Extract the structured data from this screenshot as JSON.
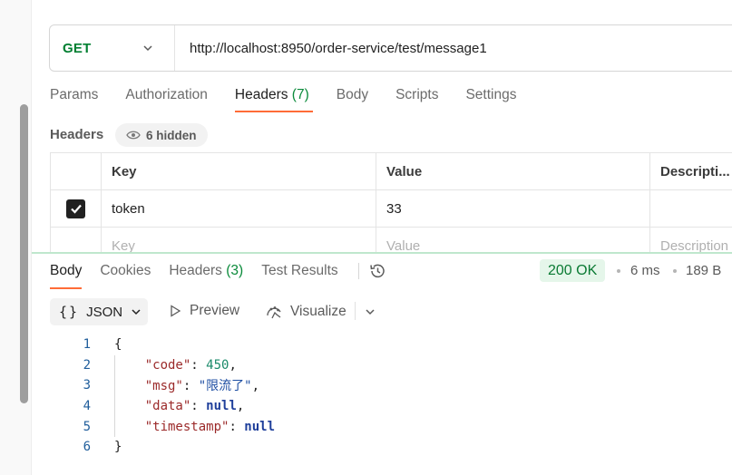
{
  "request": {
    "method": "GET",
    "url": "http://localhost:8950/order-service/test/message1"
  },
  "request_tabs": [
    {
      "label": "Params",
      "count": ""
    },
    {
      "label": "Authorization",
      "count": ""
    },
    {
      "label": "Headers",
      "count": "(7)"
    },
    {
      "label": "Body",
      "count": ""
    },
    {
      "label": "Scripts",
      "count": ""
    },
    {
      "label": "Settings",
      "count": ""
    }
  ],
  "headers_section": {
    "title": "Headers",
    "hidden_label": "6 hidden"
  },
  "headers_table": {
    "columns": [
      "Key",
      "Value",
      "Descripti..."
    ],
    "rows": [
      {
        "checked": true,
        "key": "token",
        "value": "33",
        "description": ""
      }
    ],
    "placeholder": {
      "key": "Key",
      "value": "Value",
      "description": "Description"
    }
  },
  "response_tabs": [
    {
      "label": "Body",
      "count": ""
    },
    {
      "label": "Cookies",
      "count": ""
    },
    {
      "label": "Headers",
      "count": "(3)"
    },
    {
      "label": "Test Results",
      "count": ""
    }
  ],
  "response_meta": {
    "status": "200 OK",
    "time": "6 ms",
    "size": "189 B"
  },
  "response_toolbar": {
    "format": "JSON",
    "preview": "Preview",
    "visualize": "Visualize"
  },
  "code_lines": [
    {
      "n": "1",
      "text": "{"
    },
    {
      "n": "2",
      "key": "\"code\"",
      "value": "450",
      "type": "number",
      "trail": ","
    },
    {
      "n": "3",
      "key": "\"msg\"",
      "value": "\"限流了\"",
      "type": "string",
      "trail": ","
    },
    {
      "n": "4",
      "key": "\"data\"",
      "value": "null",
      "type": "keyword",
      "trail": ","
    },
    {
      "n": "5",
      "key": "\"timestamp\"",
      "value": "null",
      "type": "keyword",
      "trail": ""
    },
    {
      "n": "6",
      "text": "}"
    }
  ],
  "colors": {
    "accent": "#ff6c37",
    "method_get": "#007f31",
    "status_ok_bg": "#e5f6ea",
    "status_ok_text": "#0a7a33"
  }
}
